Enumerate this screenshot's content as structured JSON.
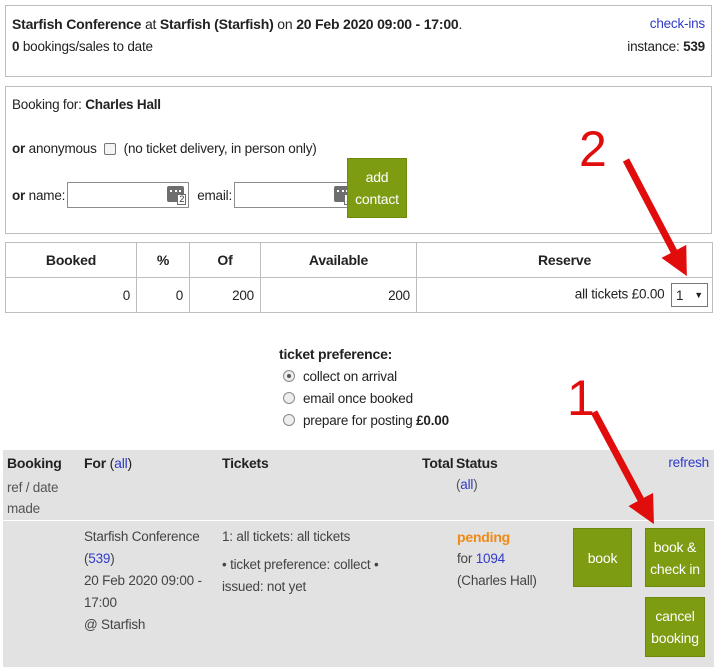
{
  "event": {
    "name": "Starfish Conference",
    "at_word": "at",
    "venue": "Starfish (Starfish)",
    "on_word": "on",
    "datetime": "20 Feb 2020 09:00 - 17:00",
    "tail": ".",
    "bookings_count": "0",
    "bookings_text": "bookings/sales to date",
    "checkins_link": "check-ins",
    "instance_label": "instance:",
    "instance_id": "539"
  },
  "booking_for": {
    "label": "Booking for:",
    "name": "Charles Hall",
    "or_label": "or",
    "anonymous_label": "anonymous",
    "anonymous_note": "(no ticket delivery, in person only)",
    "name_label": "name:",
    "email_label": "email:",
    "name_value": "",
    "email_value": "",
    "picker_badge": "2",
    "add_contact_label": "add contact"
  },
  "stats": {
    "headers": [
      "Booked",
      "%",
      "Of",
      "Available",
      "Reserve"
    ],
    "booked": "0",
    "percent": "0",
    "of": "200",
    "available": "200",
    "reserve_text": "all tickets £0.00",
    "reserve_qty": "1",
    "dropdown_arrow": "▼"
  },
  "ticket_preference": {
    "title": "ticket preference:",
    "options": [
      "collect on arrival",
      "email once booked",
      "prepare for posting"
    ],
    "posting_price": "£0.00",
    "selected_index": 0
  },
  "bookings": {
    "headers": {
      "booking": "Booking",
      "booking_sub1": "ref / date",
      "booking_sub2": "made",
      "for": "For",
      "for_all": "all",
      "tickets": "Tickets",
      "total": "Total",
      "status": "Status",
      "status_all": "all",
      "refresh": "refresh"
    },
    "row": {
      "event_name": "Starfish Conference",
      "event_instance": "539",
      "datetime": "20 Feb 2020 09:00 - 17:00",
      "venue": "@ Starfish",
      "tickets_line1": "1: all tickets: all tickets",
      "tickets_line2": "• ticket preference: collect • issued: not yet",
      "status": "pending",
      "for_word": "for",
      "contact_id": "1094",
      "contact_name": "(Charles Hall)",
      "book_label": "book",
      "book_checkin_label": "book & check in",
      "cancel_label": "cancel booking"
    }
  },
  "annotations": {
    "step1": "1",
    "step2": "2",
    "color": "#e10c0c"
  },
  "colors": {
    "button": "#7d9c12",
    "link": "#2f3ac8",
    "pending": "#ef8a17",
    "panel": "#e2e2e2"
  }
}
